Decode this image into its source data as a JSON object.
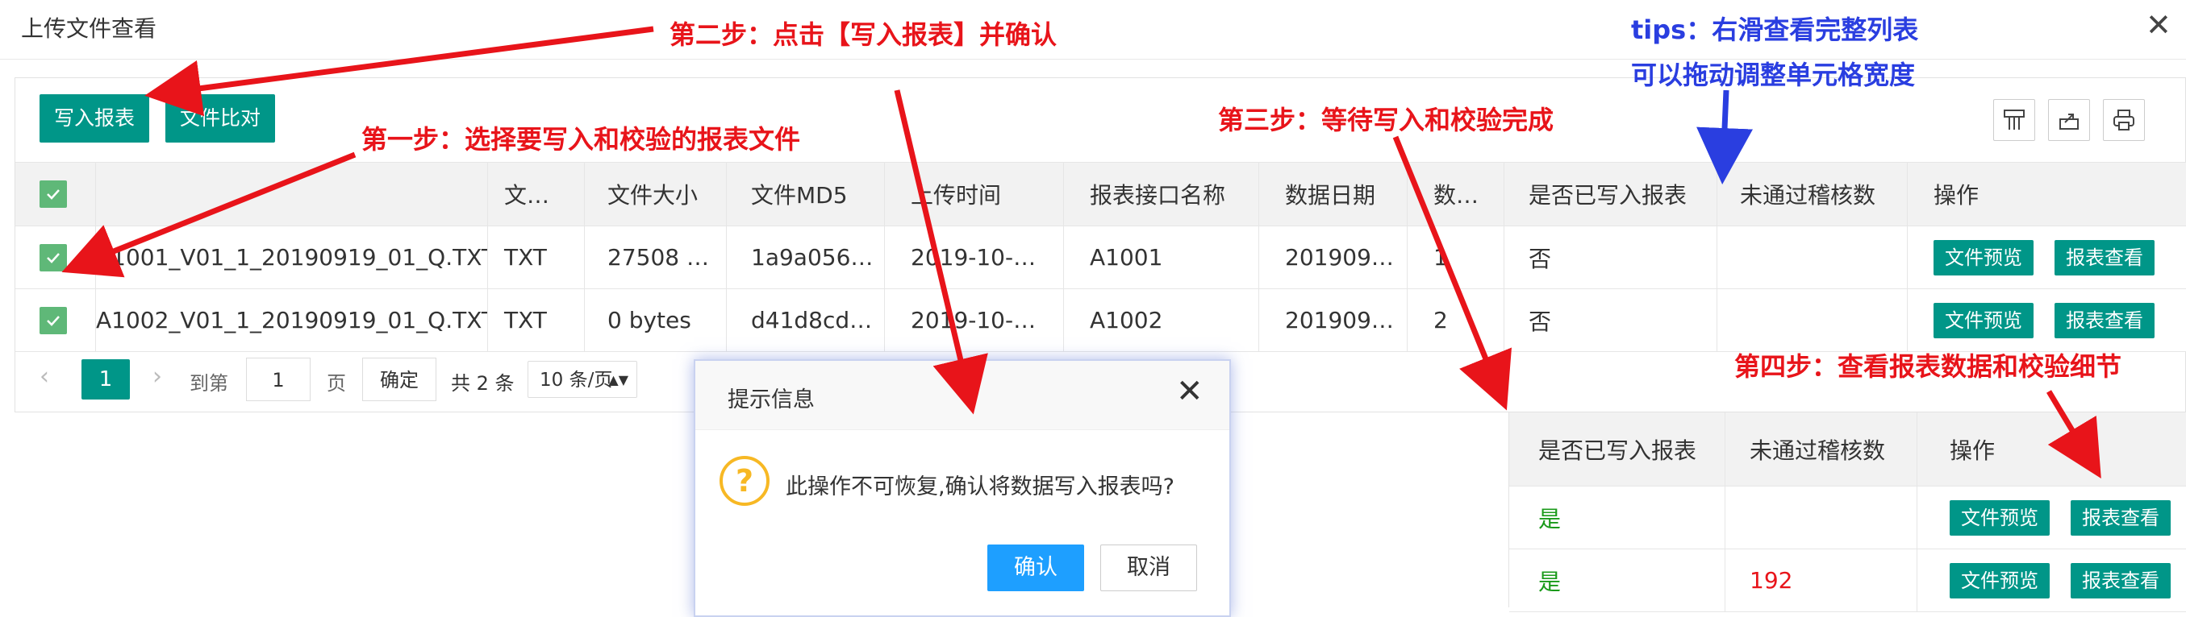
{
  "window": {
    "title": "上传文件查看",
    "close_glyph": "✕"
  },
  "toolbar": {
    "write_report": "写入报表",
    "compare_files": "文件比对"
  },
  "table": {
    "headers": [
      "文…",
      "文件大小",
      "文件MD5",
      "上传时间",
      "报表接口名称",
      "数据日期",
      "数…",
      "是否已写入报表",
      "未通过稽核数",
      "操作"
    ],
    "rows": [
      {
        "filename": "A1001_V01_1_20190919_01_Q.TXT",
        "type": "TXT",
        "size": "27508 …",
        "md5": "1a9a056…",
        "upload_time": "2019-10-…",
        "interface": "A1001",
        "data_date": "201909…",
        "count": "1",
        "written": "否",
        "failed": ""
      },
      {
        "filename": "A1002_V01_1_20190919_01_Q.TXT",
        "type": "TXT",
        "size": "0 bytes",
        "md5": "d41d8cd…",
        "upload_time": "2019-10-…",
        "interface": "A1002",
        "data_date": "201909…",
        "count": "2",
        "written": "否",
        "failed": ""
      }
    ],
    "action_preview": "文件预览",
    "action_report": "报表查看"
  },
  "pager": {
    "prev": "‹",
    "current": "1",
    "next": "›",
    "goto_label": "到第",
    "goto_value": "1",
    "page_unit": "页",
    "confirm": "确定",
    "total": "共 2 条",
    "page_size": "10 条/页"
  },
  "dialog": {
    "title": "提示信息",
    "close": "✕",
    "icon": "?",
    "message": "此操作不可恢复,确认将数据写入报表吗?",
    "ok": "确认",
    "cancel": "取消"
  },
  "zoom": {
    "headers": [
      "是否已写入报表",
      "未通过稽核数",
      "操作"
    ],
    "rows": [
      {
        "written": "是",
        "failed": ""
      },
      {
        "written": "是",
        "failed": "192"
      }
    ],
    "written_color": "#1a9a1a",
    "failed_color": "#e8141a"
  },
  "annotations": {
    "step1": "第一步：选择要写入和校验的报表文件",
    "step2": "第二步：点击【写入报表】并确认",
    "step3": "第三步：等待写入和校验完成",
    "step4": "第四步：查看报表数据和校验细节",
    "tips1": "tips：右滑查看完整列表",
    "tips2": "可以拖动调整单元格宽度"
  },
  "colors": {
    "accent": "#009688",
    "checkbox": "#5fb878",
    "annotation_red": "#e8141a",
    "tips_blue": "#2a3ee0",
    "dialog_ok": "#1e9fff"
  }
}
